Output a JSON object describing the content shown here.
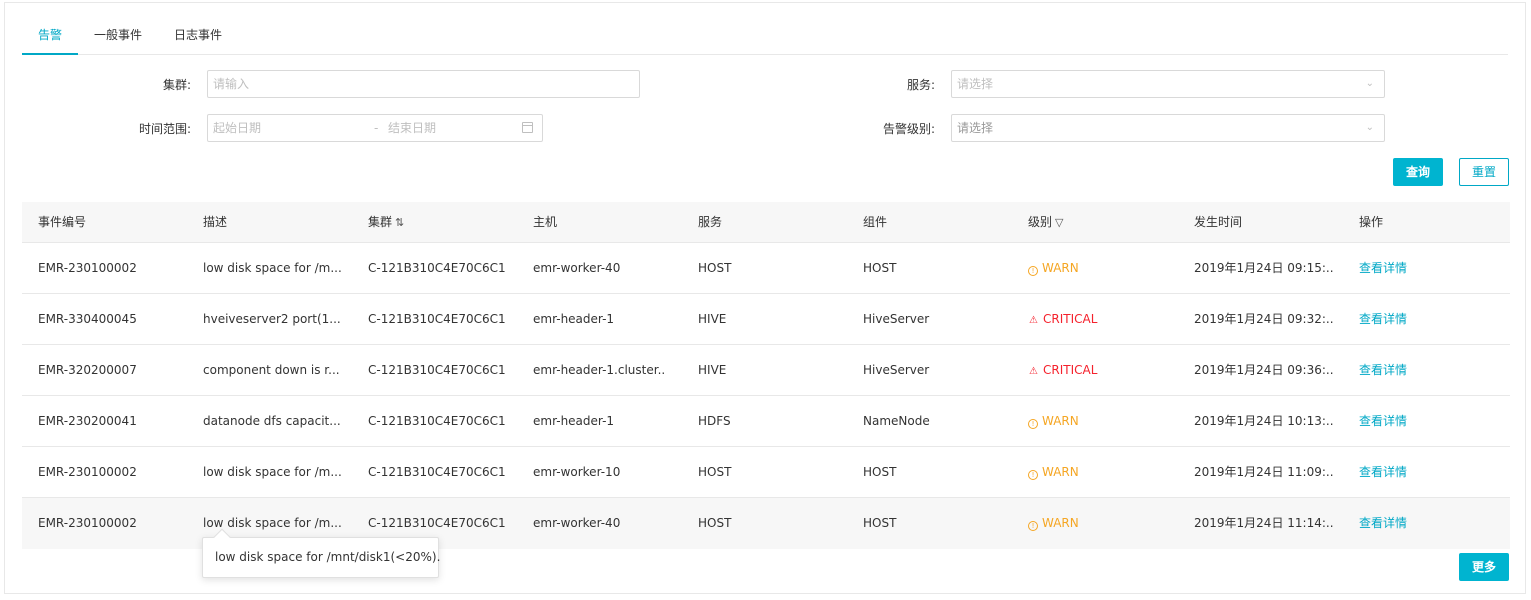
{
  "tabs": [
    {
      "label": "告警"
    },
    {
      "label": "一般事件"
    },
    {
      "label": "日志事件"
    }
  ],
  "filters": {
    "cluster_label": "集群:",
    "cluster_placeholder": "请输入",
    "service_label": "服务:",
    "service_placeholder": "请选择",
    "time_label": "时间范围:",
    "start_placeholder": "起始日期",
    "date_separator": "-",
    "end_placeholder": "结束日期",
    "level_label": "告警级别:",
    "level_placeholder": "请选择"
  },
  "buttons": {
    "query": "查询",
    "reset": "重置",
    "more": "更多"
  },
  "table": {
    "headers": [
      "事件编号",
      "描述",
      "集群",
      "主机",
      "服务",
      "组件",
      "级别",
      "发生时间",
      "操作"
    ],
    "rows": [
      {
        "id": "EMR-230100002",
        "desc": "low disk space for /m...",
        "cluster": "C-121B310C4E70C6C1",
        "host": "emr-worker-40",
        "service": "HOST",
        "component": "HOST",
        "level": "WARN",
        "time": "2019年1月24日 09:15:...",
        "action": "查看详情"
      },
      {
        "id": "EMR-330400045",
        "desc": "hveiveserver2 port(1...",
        "cluster": "C-121B310C4E70C6C1",
        "host": "emr-header-1",
        "service": "HIVE",
        "component": "HiveServer",
        "level": "CRITICAL",
        "time": "2019年1月24日 09:32:...",
        "action": "查看详情"
      },
      {
        "id": "EMR-320200007",
        "desc": "component down is r...",
        "cluster": "C-121B310C4E70C6C1",
        "host": "emr-header-1.cluster...",
        "service": "HIVE",
        "component": "HiveServer",
        "level": "CRITICAL",
        "time": "2019年1月24日 09:36:...",
        "action": "查看详情"
      },
      {
        "id": "EMR-230200041",
        "desc": "datanode dfs capacit...",
        "cluster": "C-121B310C4E70C6C1",
        "host": "emr-header-1",
        "service": "HDFS",
        "component": "NameNode",
        "level": "WARN",
        "time": "2019年1月24日 10:13:...",
        "action": "查看详情"
      },
      {
        "id": "EMR-230100002",
        "desc": "low disk space for /m...",
        "cluster": "C-121B310C4E70C6C1",
        "host": "emr-worker-10",
        "service": "HOST",
        "component": "HOST",
        "level": "WARN",
        "time": "2019年1月24日 11:09:...",
        "action": "查看详情"
      },
      {
        "id": "EMR-230100002",
        "desc": "low disk space for /m...",
        "cluster": "C-121B310C4E70C6C1",
        "host": "emr-worker-40",
        "service": "HOST",
        "component": "HOST",
        "level": "WARN",
        "time": "2019年1月24日 11:14:...",
        "action": "查看详情"
      }
    ]
  },
  "tooltip": {
    "text": "low disk space for /mnt/disk1(<20%)."
  },
  "colors": {
    "accent": "#00a8c6",
    "warn": "#f5a623",
    "critical": "#f5222d"
  }
}
